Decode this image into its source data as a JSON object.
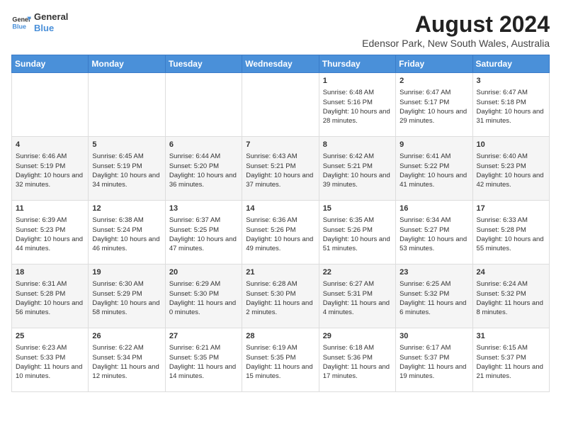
{
  "header": {
    "logo_line1": "General",
    "logo_line2": "Blue",
    "title": "August 2024",
    "subtitle": "Edensor Park, New South Wales, Australia"
  },
  "weekdays": [
    "Sunday",
    "Monday",
    "Tuesday",
    "Wednesday",
    "Thursday",
    "Friday",
    "Saturday"
  ],
  "weeks": [
    [
      {
        "day": "",
        "info": ""
      },
      {
        "day": "",
        "info": ""
      },
      {
        "day": "",
        "info": ""
      },
      {
        "day": "",
        "info": ""
      },
      {
        "day": "1",
        "info": "Sunrise: 6:48 AM\nSunset: 5:16 PM\nDaylight: 10 hours and 28 minutes."
      },
      {
        "day": "2",
        "info": "Sunrise: 6:47 AM\nSunset: 5:17 PM\nDaylight: 10 hours and 29 minutes."
      },
      {
        "day": "3",
        "info": "Sunrise: 6:47 AM\nSunset: 5:18 PM\nDaylight: 10 hours and 31 minutes."
      }
    ],
    [
      {
        "day": "4",
        "info": "Sunrise: 6:46 AM\nSunset: 5:19 PM\nDaylight: 10 hours and 32 minutes."
      },
      {
        "day": "5",
        "info": "Sunrise: 6:45 AM\nSunset: 5:19 PM\nDaylight: 10 hours and 34 minutes."
      },
      {
        "day": "6",
        "info": "Sunrise: 6:44 AM\nSunset: 5:20 PM\nDaylight: 10 hours and 36 minutes."
      },
      {
        "day": "7",
        "info": "Sunrise: 6:43 AM\nSunset: 5:21 PM\nDaylight: 10 hours and 37 minutes."
      },
      {
        "day": "8",
        "info": "Sunrise: 6:42 AM\nSunset: 5:21 PM\nDaylight: 10 hours and 39 minutes."
      },
      {
        "day": "9",
        "info": "Sunrise: 6:41 AM\nSunset: 5:22 PM\nDaylight: 10 hours and 41 minutes."
      },
      {
        "day": "10",
        "info": "Sunrise: 6:40 AM\nSunset: 5:23 PM\nDaylight: 10 hours and 42 minutes."
      }
    ],
    [
      {
        "day": "11",
        "info": "Sunrise: 6:39 AM\nSunset: 5:23 PM\nDaylight: 10 hours and 44 minutes."
      },
      {
        "day": "12",
        "info": "Sunrise: 6:38 AM\nSunset: 5:24 PM\nDaylight: 10 hours and 46 minutes."
      },
      {
        "day": "13",
        "info": "Sunrise: 6:37 AM\nSunset: 5:25 PM\nDaylight: 10 hours and 47 minutes."
      },
      {
        "day": "14",
        "info": "Sunrise: 6:36 AM\nSunset: 5:26 PM\nDaylight: 10 hours and 49 minutes."
      },
      {
        "day": "15",
        "info": "Sunrise: 6:35 AM\nSunset: 5:26 PM\nDaylight: 10 hours and 51 minutes."
      },
      {
        "day": "16",
        "info": "Sunrise: 6:34 AM\nSunset: 5:27 PM\nDaylight: 10 hours and 53 minutes."
      },
      {
        "day": "17",
        "info": "Sunrise: 6:33 AM\nSunset: 5:28 PM\nDaylight: 10 hours and 55 minutes."
      }
    ],
    [
      {
        "day": "18",
        "info": "Sunrise: 6:31 AM\nSunset: 5:28 PM\nDaylight: 10 hours and 56 minutes."
      },
      {
        "day": "19",
        "info": "Sunrise: 6:30 AM\nSunset: 5:29 PM\nDaylight: 10 hours and 58 minutes."
      },
      {
        "day": "20",
        "info": "Sunrise: 6:29 AM\nSunset: 5:30 PM\nDaylight: 11 hours and 0 minutes."
      },
      {
        "day": "21",
        "info": "Sunrise: 6:28 AM\nSunset: 5:30 PM\nDaylight: 11 hours and 2 minutes."
      },
      {
        "day": "22",
        "info": "Sunrise: 6:27 AM\nSunset: 5:31 PM\nDaylight: 11 hours and 4 minutes."
      },
      {
        "day": "23",
        "info": "Sunrise: 6:25 AM\nSunset: 5:32 PM\nDaylight: 11 hours and 6 minutes."
      },
      {
        "day": "24",
        "info": "Sunrise: 6:24 AM\nSunset: 5:32 PM\nDaylight: 11 hours and 8 minutes."
      }
    ],
    [
      {
        "day": "25",
        "info": "Sunrise: 6:23 AM\nSunset: 5:33 PM\nDaylight: 11 hours and 10 minutes."
      },
      {
        "day": "26",
        "info": "Sunrise: 6:22 AM\nSunset: 5:34 PM\nDaylight: 11 hours and 12 minutes."
      },
      {
        "day": "27",
        "info": "Sunrise: 6:21 AM\nSunset: 5:35 PM\nDaylight: 11 hours and 14 minutes."
      },
      {
        "day": "28",
        "info": "Sunrise: 6:19 AM\nSunset: 5:35 PM\nDaylight: 11 hours and 15 minutes."
      },
      {
        "day": "29",
        "info": "Sunrise: 6:18 AM\nSunset: 5:36 PM\nDaylight: 11 hours and 17 minutes."
      },
      {
        "day": "30",
        "info": "Sunrise: 6:17 AM\nSunset: 5:37 PM\nDaylight: 11 hours and 19 minutes."
      },
      {
        "day": "31",
        "info": "Sunrise: 6:15 AM\nSunset: 5:37 PM\nDaylight: 11 hours and 21 minutes."
      }
    ]
  ]
}
